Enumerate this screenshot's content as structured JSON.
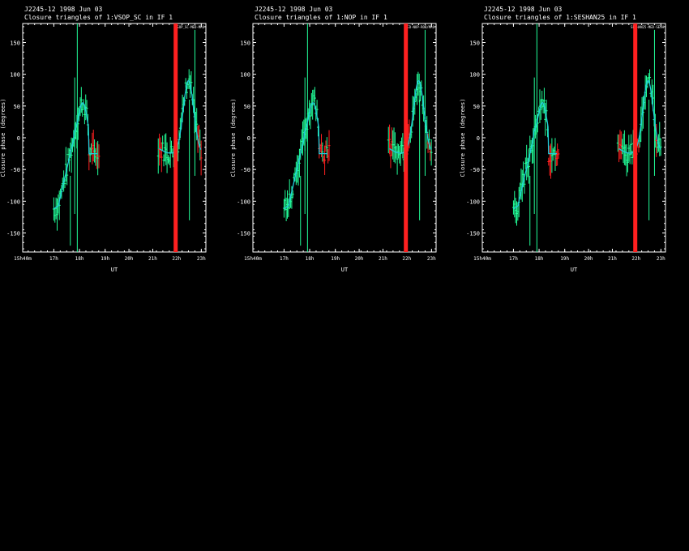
{
  "colors": {
    "background": "#000000",
    "axes": "#ffffff",
    "points": "#22ff99",
    "flagged": "#ff2020",
    "model": "#22ccdd"
  },
  "chart_data": [
    {
      "type": "scatter",
      "header": "J2245-12   1998 Jun 03",
      "title": "Closure triangles of 1:VSOP_SC in IF 1",
      "legend": "VSOP_SC-MED-MRO",
      "xlabel": "UT",
      "ylabel": "Closure phase   (degrees)",
      "ylim": [
        -180,
        180
      ],
      "yticks": [
        -150,
        -100,
        -50,
        0,
        50,
        100,
        150
      ],
      "xticks": [
        "15h40m",
        "17h",
        "18h",
        "19h",
        "20h",
        "21h",
        "22h",
        "23h"
      ]
    },
    {
      "type": "scatter",
      "header": "J2245-12   1998 Jun 03",
      "title": "Closure triangles of 1:NOP in IF 1",
      "legend": "MED-NOP-ROB/MRO",
      "xlabel": "UT",
      "ylabel": "Closure phase   (degrees)",
      "ylim": [
        -180,
        180
      ],
      "yticks": [
        -150,
        -100,
        -50,
        0,
        50,
        100,
        150
      ],
      "xticks": [
        "15h40m",
        "17h",
        "18h",
        "19h",
        "20h",
        "21h",
        "22h",
        "23h"
      ]
    },
    {
      "type": "scatter",
      "header": "J2245-12   1998 Jun 03",
      "title": "Closure triangles of 1:SESHAN25 in IF 1",
      "legend": "SESHAN25-MED-SESH",
      "xlabel": "UT",
      "ylabel": "Closure phase   (degrees)",
      "ylim": [
        -180,
        180
      ],
      "yticks": [
        -150,
        -100,
        -50,
        0,
        50,
        100,
        150
      ],
      "xticks": [
        "15h40m",
        "17h",
        "18h",
        "19h",
        "20h",
        "21h",
        "22h",
        "23h"
      ]
    }
  ]
}
